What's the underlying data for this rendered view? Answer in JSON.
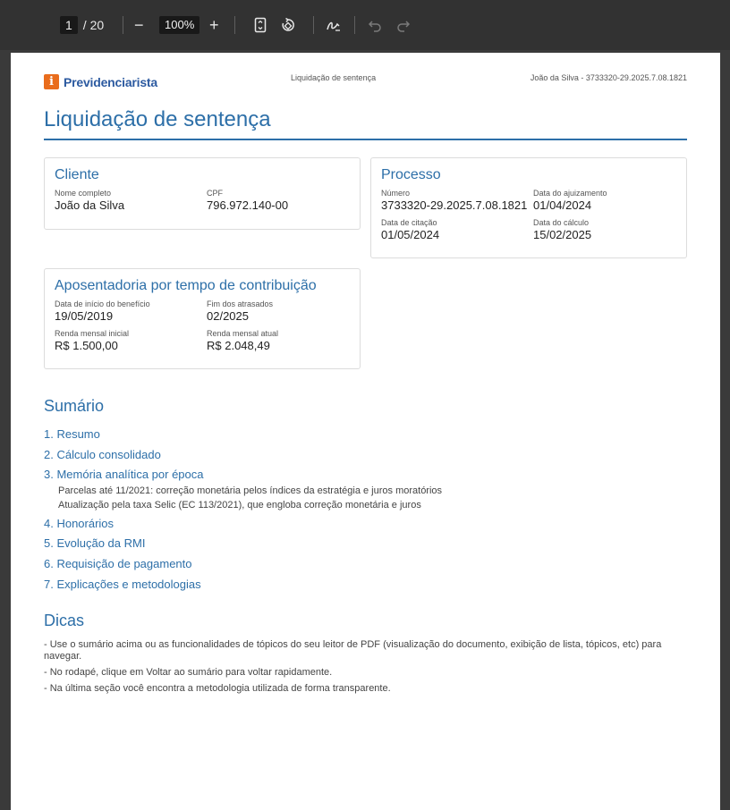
{
  "toolbar": {
    "page_current": "1",
    "page_total": "/ 20",
    "zoom": "100%",
    "minus": "−",
    "plus": "+"
  },
  "header": {
    "logo_text": "Previdenciarista",
    "center": "Liquidação de sentença",
    "right": "João da Silva - 3733320-29.2025.7.08.1821"
  },
  "title": "Liquidação de sentença",
  "cliente": {
    "heading": "Cliente",
    "nome_label": "Nome completo",
    "nome_value": "João da Silva",
    "cpf_label": "CPF",
    "cpf_value": "796.972.140-00"
  },
  "processo": {
    "heading": "Processo",
    "numero_label": "Número",
    "numero_value": "3733320-29.2025.7.08.1821",
    "ajuizamento_label": "Data do ajuizamento",
    "ajuizamento_value": "01/04/2024",
    "citacao_label": "Data de citação",
    "citacao_value": "01/05/2024",
    "calculo_label": "Data do cálculo",
    "calculo_value": "15/02/2025"
  },
  "beneficio": {
    "heading": "Aposentadoria por tempo de contribuição",
    "dib_label": "Data de início do benefício",
    "dib_value": "19/05/2019",
    "fim_label": "Fim dos atrasados",
    "fim_value": "02/2025",
    "rmi_label": "Renda mensal inicial",
    "rmi_value": "R$ 1.500,00",
    "rma_label": "Renda mensal atual",
    "rma_value": "R$ 2.048,49"
  },
  "sumario": {
    "heading": "Sumário",
    "items": [
      "1. Resumo",
      "2. Cálculo consolidado",
      "3. Memória analítica por época",
      "4. Honorários",
      "5. Evolução da RMI",
      "6. Requisição de pagamento",
      "7. Explicações e metodologias"
    ],
    "subitems": [
      "Parcelas até 11/2021: correção monetária pelos índices da estratégia e juros moratórios",
      "Atualização pela taxa Selic (EC 113/2021), que engloba correção monetária e juros"
    ]
  },
  "dicas": {
    "heading": "Dicas",
    "items": [
      "- Use o sumário acima ou as funcionalidades de tópicos do seu leitor de PDF (visualização do documento, exibição de lista, tópicos, etc) para navegar.",
      "- No rodapé, clique em Voltar ao sumário para voltar rapidamente.",
      "- Na última seção você encontra a metodologia utilizada de forma transparente."
    ]
  }
}
